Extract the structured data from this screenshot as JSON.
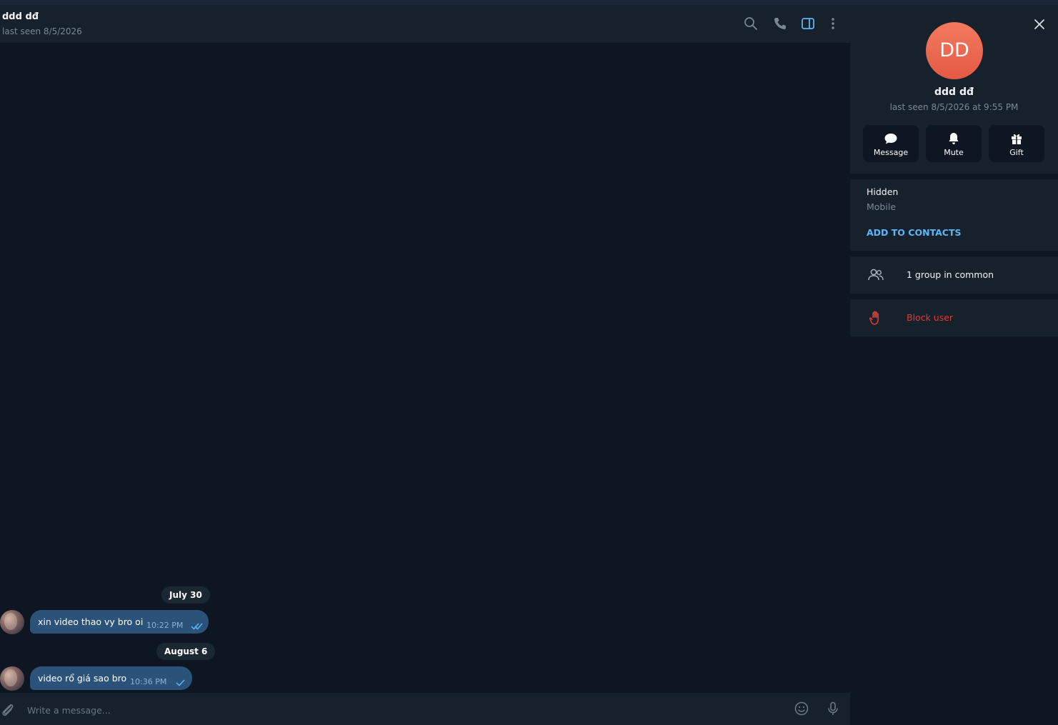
{
  "header": {
    "title": "ddd dđ",
    "status": "last seen 8/5/2026"
  },
  "icons": {
    "search": "search-icon",
    "call": "phone-icon",
    "sidebar": "sidebar-toggle-icon",
    "more": "more-vertical-icon",
    "attach": "paperclip-icon",
    "emoji": "emoji-icon",
    "mic": "microphone-icon",
    "close": "close-icon"
  },
  "messages": [
    {
      "date": "July 30",
      "text": "xin video thao vy bro oi",
      "time": "10:22 PM",
      "status": "read"
    },
    {
      "date": "August 6",
      "text": "video rổ giá sao bro",
      "time": "10:36 PM",
      "status": "sent"
    }
  ],
  "composer": {
    "placeholder": "Write a message..."
  },
  "profile": {
    "initials": "DD",
    "name": "ddd dđ",
    "status": "last seen 8/5/2026 at 9:55 PM",
    "avatar_color": "#e9604a",
    "actions": [
      {
        "label": "Message"
      },
      {
        "label": "Mute"
      },
      {
        "label": "Gift"
      }
    ],
    "phone_value": "Hidden",
    "phone_label": "Mobile",
    "add_contacts": "ADD TO CONTACTS",
    "groups_in_common": "1 group in common",
    "block_user": "Block user"
  },
  "colors": {
    "accent": "#5eb5f7",
    "danger": "#e53935",
    "bubble": "#2b5278"
  }
}
